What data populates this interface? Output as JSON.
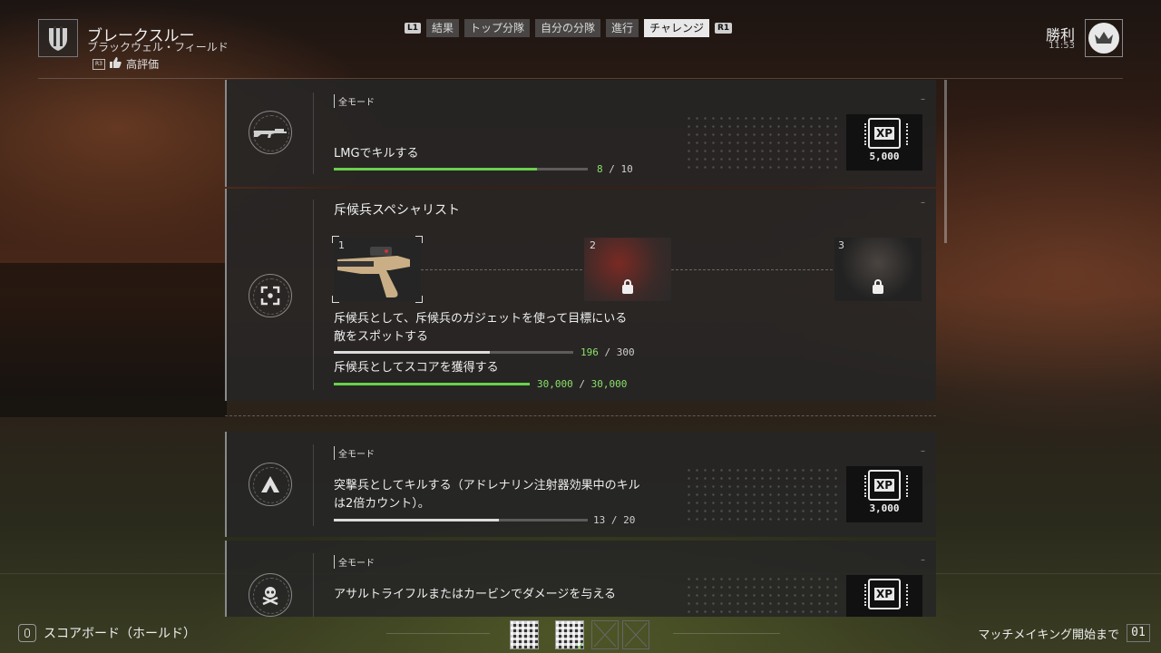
{
  "header": {
    "mode_title": "ブレークスルー",
    "map_name": "ブラックウェル・フィールド",
    "rating_label": "高評価",
    "result_label": "勝利",
    "time": "11:53",
    "bumper_left": "L1",
    "bumper_right": "R1",
    "tabs": [
      {
        "label": "結果",
        "active": false
      },
      {
        "label": "トップ分隊",
        "active": false
      },
      {
        "label": "自分の分隊",
        "active": false
      },
      {
        "label": "進行",
        "active": false
      },
      {
        "label": "チャレンジ",
        "active": true
      }
    ]
  },
  "challenges": [
    {
      "mode": "全モード",
      "title": "LMGでキルする",
      "progress_current": "8",
      "progress_total": "10",
      "progress_fraction": 0.8,
      "reward_xp": "5,000",
      "reward_label": "XP"
    },
    {
      "title": "斥候兵スペシャリスト",
      "stages": [
        "1",
        "2",
        "3"
      ],
      "objectives": [
        {
          "text": "斥候兵として、斥候兵のガジェットを使って目標にいる敵をスポットする",
          "progress_current": "196",
          "progress_total": "300",
          "progress_fraction": 0.65
        },
        {
          "text": "斥候兵としてスコアを獲得する",
          "progress_current": "30,000",
          "progress_total": "30,000",
          "progress_fraction": 1.0
        }
      ]
    },
    {
      "mode": "全モード",
      "title": "突撃兵としてキルする（アドレナリン注射器効果中のキルは2倍カウント）。",
      "progress_current": "13",
      "progress_total": "20",
      "progress_fraction": 0.65,
      "reward_xp": "3,000",
      "reward_label": "XP"
    },
    {
      "mode": "全モード",
      "title": "アサルトライフルまたはカービンでダメージを与える",
      "reward_label": "XP"
    }
  ],
  "footer": {
    "scoreboard_label": "スコアボード（ホールド）",
    "matchmaking_label": "マッチメイキング開始まで",
    "counter": "01"
  },
  "colors": {
    "progress_green": "#6ad04c",
    "active_tab": "#e8e8e8"
  }
}
